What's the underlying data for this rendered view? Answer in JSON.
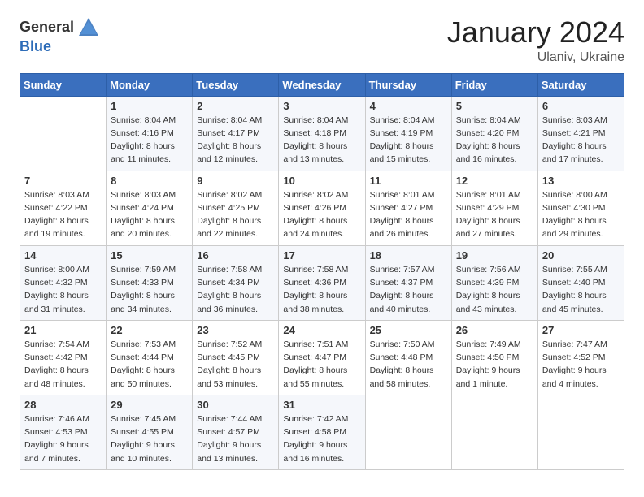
{
  "logo": {
    "general": "General",
    "blue": "Blue"
  },
  "title": "January 2024",
  "subtitle": "Ulaniv, Ukraine",
  "weekdays": [
    "Sunday",
    "Monday",
    "Tuesday",
    "Wednesday",
    "Thursday",
    "Friday",
    "Saturday"
  ],
  "weeks": [
    [
      {
        "day": null,
        "sunrise": null,
        "sunset": null,
        "daylight": null
      },
      {
        "day": "1",
        "sunrise": "Sunrise: 8:04 AM",
        "sunset": "Sunset: 4:16 PM",
        "daylight": "Daylight: 8 hours and 11 minutes."
      },
      {
        "day": "2",
        "sunrise": "Sunrise: 8:04 AM",
        "sunset": "Sunset: 4:17 PM",
        "daylight": "Daylight: 8 hours and 12 minutes."
      },
      {
        "day": "3",
        "sunrise": "Sunrise: 8:04 AM",
        "sunset": "Sunset: 4:18 PM",
        "daylight": "Daylight: 8 hours and 13 minutes."
      },
      {
        "day": "4",
        "sunrise": "Sunrise: 8:04 AM",
        "sunset": "Sunset: 4:19 PM",
        "daylight": "Daylight: 8 hours and 15 minutes."
      },
      {
        "day": "5",
        "sunrise": "Sunrise: 8:04 AM",
        "sunset": "Sunset: 4:20 PM",
        "daylight": "Daylight: 8 hours and 16 minutes."
      },
      {
        "day": "6",
        "sunrise": "Sunrise: 8:03 AM",
        "sunset": "Sunset: 4:21 PM",
        "daylight": "Daylight: 8 hours and 17 minutes."
      }
    ],
    [
      {
        "day": "7",
        "sunrise": "Sunrise: 8:03 AM",
        "sunset": "Sunset: 4:22 PM",
        "daylight": "Daylight: 8 hours and 19 minutes."
      },
      {
        "day": "8",
        "sunrise": "Sunrise: 8:03 AM",
        "sunset": "Sunset: 4:24 PM",
        "daylight": "Daylight: 8 hours and 20 minutes."
      },
      {
        "day": "9",
        "sunrise": "Sunrise: 8:02 AM",
        "sunset": "Sunset: 4:25 PM",
        "daylight": "Daylight: 8 hours and 22 minutes."
      },
      {
        "day": "10",
        "sunrise": "Sunrise: 8:02 AM",
        "sunset": "Sunset: 4:26 PM",
        "daylight": "Daylight: 8 hours and 24 minutes."
      },
      {
        "day": "11",
        "sunrise": "Sunrise: 8:01 AM",
        "sunset": "Sunset: 4:27 PM",
        "daylight": "Daylight: 8 hours and 26 minutes."
      },
      {
        "day": "12",
        "sunrise": "Sunrise: 8:01 AM",
        "sunset": "Sunset: 4:29 PM",
        "daylight": "Daylight: 8 hours and 27 minutes."
      },
      {
        "day": "13",
        "sunrise": "Sunrise: 8:00 AM",
        "sunset": "Sunset: 4:30 PM",
        "daylight": "Daylight: 8 hours and 29 minutes."
      }
    ],
    [
      {
        "day": "14",
        "sunrise": "Sunrise: 8:00 AM",
        "sunset": "Sunset: 4:32 PM",
        "daylight": "Daylight: 8 hours and 31 minutes."
      },
      {
        "day": "15",
        "sunrise": "Sunrise: 7:59 AM",
        "sunset": "Sunset: 4:33 PM",
        "daylight": "Daylight: 8 hours and 34 minutes."
      },
      {
        "day": "16",
        "sunrise": "Sunrise: 7:58 AM",
        "sunset": "Sunset: 4:34 PM",
        "daylight": "Daylight: 8 hours and 36 minutes."
      },
      {
        "day": "17",
        "sunrise": "Sunrise: 7:58 AM",
        "sunset": "Sunset: 4:36 PM",
        "daylight": "Daylight: 8 hours and 38 minutes."
      },
      {
        "day": "18",
        "sunrise": "Sunrise: 7:57 AM",
        "sunset": "Sunset: 4:37 PM",
        "daylight": "Daylight: 8 hours and 40 minutes."
      },
      {
        "day": "19",
        "sunrise": "Sunrise: 7:56 AM",
        "sunset": "Sunset: 4:39 PM",
        "daylight": "Daylight: 8 hours and 43 minutes."
      },
      {
        "day": "20",
        "sunrise": "Sunrise: 7:55 AM",
        "sunset": "Sunset: 4:40 PM",
        "daylight": "Daylight: 8 hours and 45 minutes."
      }
    ],
    [
      {
        "day": "21",
        "sunrise": "Sunrise: 7:54 AM",
        "sunset": "Sunset: 4:42 PM",
        "daylight": "Daylight: 8 hours and 48 minutes."
      },
      {
        "day": "22",
        "sunrise": "Sunrise: 7:53 AM",
        "sunset": "Sunset: 4:44 PM",
        "daylight": "Daylight: 8 hours and 50 minutes."
      },
      {
        "day": "23",
        "sunrise": "Sunrise: 7:52 AM",
        "sunset": "Sunset: 4:45 PM",
        "daylight": "Daylight: 8 hours and 53 minutes."
      },
      {
        "day": "24",
        "sunrise": "Sunrise: 7:51 AM",
        "sunset": "Sunset: 4:47 PM",
        "daylight": "Daylight: 8 hours and 55 minutes."
      },
      {
        "day": "25",
        "sunrise": "Sunrise: 7:50 AM",
        "sunset": "Sunset: 4:48 PM",
        "daylight": "Daylight: 8 hours and 58 minutes."
      },
      {
        "day": "26",
        "sunrise": "Sunrise: 7:49 AM",
        "sunset": "Sunset: 4:50 PM",
        "daylight": "Daylight: 9 hours and 1 minute."
      },
      {
        "day": "27",
        "sunrise": "Sunrise: 7:47 AM",
        "sunset": "Sunset: 4:52 PM",
        "daylight": "Daylight: 9 hours and 4 minutes."
      }
    ],
    [
      {
        "day": "28",
        "sunrise": "Sunrise: 7:46 AM",
        "sunset": "Sunset: 4:53 PM",
        "daylight": "Daylight: 9 hours and 7 minutes."
      },
      {
        "day": "29",
        "sunrise": "Sunrise: 7:45 AM",
        "sunset": "Sunset: 4:55 PM",
        "daylight": "Daylight: 9 hours and 10 minutes."
      },
      {
        "day": "30",
        "sunrise": "Sunrise: 7:44 AM",
        "sunset": "Sunset: 4:57 PM",
        "daylight": "Daylight: 9 hours and 13 minutes."
      },
      {
        "day": "31",
        "sunrise": "Sunrise: 7:42 AM",
        "sunset": "Sunset: 4:58 PM",
        "daylight": "Daylight: 9 hours and 16 minutes."
      },
      {
        "day": null,
        "sunrise": null,
        "sunset": null,
        "daylight": null
      },
      {
        "day": null,
        "sunrise": null,
        "sunset": null,
        "daylight": null
      },
      {
        "day": null,
        "sunrise": null,
        "sunset": null,
        "daylight": null
      }
    ]
  ]
}
